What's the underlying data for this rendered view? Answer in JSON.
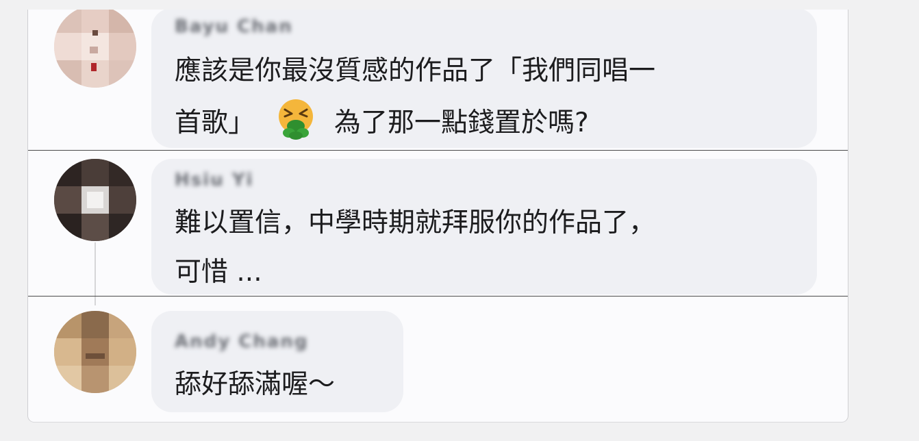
{
  "comments": [
    {
      "author": "Bayu Chan",
      "line1": "應該是你最沒質感的作品了「我們同唱一",
      "line2_before_emoji": "首歌」",
      "emoji_name": "nauseated-vomiting-face-icon",
      "line2_after_emoji": "為了那一點錢置於嗎?"
    },
    {
      "author": "Hsiu Yi",
      "line1": "難以置信，中學時期就拜服你的作品了，",
      "line2": "可惜 ..."
    },
    {
      "author": "Andy Chang",
      "line1": "舔好舔滿喔～"
    }
  ],
  "colors": {
    "page_background": "#f1f1f2",
    "card_background": "#fbfbfd",
    "bubble_background": "#eff0f4",
    "text": "#1c1c1e",
    "separator": "#4a4a4a"
  }
}
